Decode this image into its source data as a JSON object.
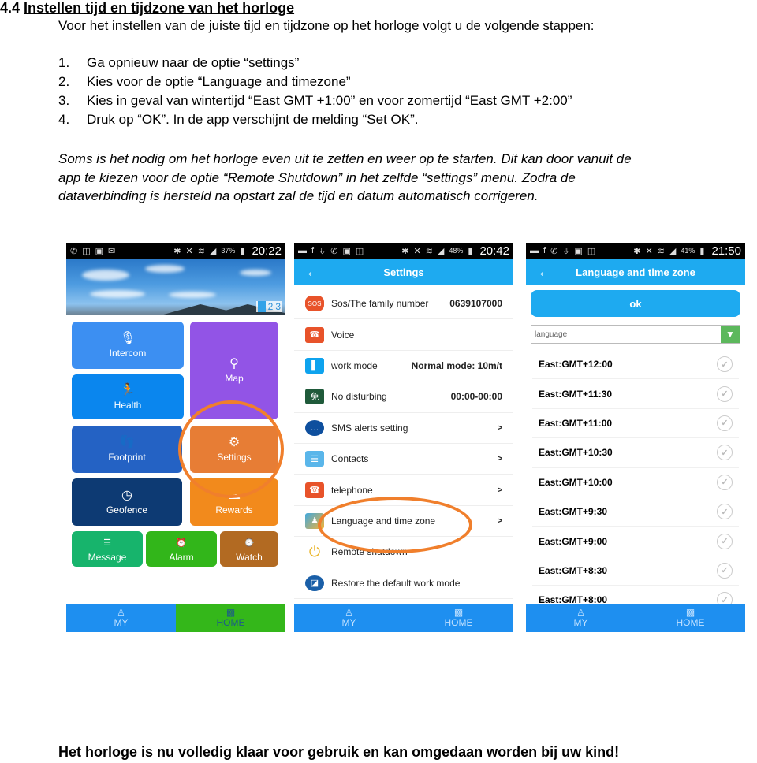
{
  "heading": {
    "number": "4.4",
    "title": "Instellen tijd en tijdzone van het horloge"
  },
  "intro": "Voor het instellen van de juiste tijd en tijdzone op het horloge volgt u de volgende stappen:",
  "steps": [
    {
      "n": "1.",
      "text": "Ga opnieuw naar de optie “settings”"
    },
    {
      "n": "2.",
      "text": "Kies voor de optie “Language and timezone”"
    },
    {
      "n": "3.",
      "text": "Kies in geval van wintertijd “East GMT +1:00” en voor zomertijd “East GMT +2:00”"
    },
    {
      "n": "4.",
      "text": "Druk op “OK”. In de app verschijnt de melding “Set OK”."
    }
  ],
  "note": [
    "Soms is het nodig om het horloge even uit te zetten en weer op te starten. Dit kan door vanuit de",
    "app te kiezen voor de optie “Remote Shutdown” in het zelfde “settings” menu. Zodra de",
    "dataverbinding is hersteld na opstart zal de tijd en datum automatisch corrigeren."
  ],
  "footer": "Het horloge is nu volledig klaar voor gebruik en kan omgedaan worden bij uw kind!",
  "phone_home": {
    "status": {
      "battery": "37%",
      "time": "20:22"
    },
    "pager": [
      "1",
      "2",
      "3"
    ],
    "tiles": {
      "intercom": "Intercom",
      "map": "Map",
      "health": "Health",
      "footprint": "Footprint",
      "settings": "Settings",
      "geofence": "Geofence",
      "rewards": "Rewards",
      "message": "Message",
      "alarm": "Alarm",
      "watch": "Watch"
    },
    "nav": {
      "my": "MY",
      "home": "HOME"
    }
  },
  "phone_settings": {
    "status": {
      "battery": "48%",
      "time": "20:42"
    },
    "title": "Settings",
    "rows": [
      {
        "icon": "sos-icon",
        "label": "Sos/The family number",
        "value": "0639107000"
      },
      {
        "icon": "voice-icon",
        "label": "Voice",
        "value": ""
      },
      {
        "icon": "work-mode-icon",
        "label": "work mode",
        "value": "Normal mode: 10m/t"
      },
      {
        "icon": "no-disturb-icon",
        "label": "No disturbing",
        "value": "00:00-00:00"
      },
      {
        "icon": "sms-icon",
        "label": "SMS alerts setting",
        "value": ">"
      },
      {
        "icon": "contacts-icon",
        "label": "Contacts",
        "value": ">"
      },
      {
        "icon": "telephone-icon",
        "label": "telephone",
        "value": ">"
      },
      {
        "icon": "language-icon",
        "label": "Language and time zone",
        "value": ">"
      },
      {
        "icon": "power-icon",
        "label": "Remote shutdown",
        "value": ""
      },
      {
        "icon": "restore-icon",
        "label": "Restore the default work mode",
        "value": ""
      }
    ],
    "nav": {
      "my": "MY",
      "home": "HOME"
    }
  },
  "phone_language": {
    "status": {
      "battery": "41%",
      "time": "21:50"
    },
    "title": "Language and time zone",
    "ok_label": "ok",
    "select_value": "language",
    "timezones": [
      "East:GMT+12:00",
      "East:GMT+11:30",
      "East:GMT+11:00",
      "East:GMT+10:30",
      "East:GMT+10:00",
      "East:GMT+9:30",
      "East:GMT+9:00",
      "East:GMT+8:30",
      "East:GMT+8:00"
    ],
    "nav": {
      "my": "MY",
      "home": "HOME"
    }
  }
}
